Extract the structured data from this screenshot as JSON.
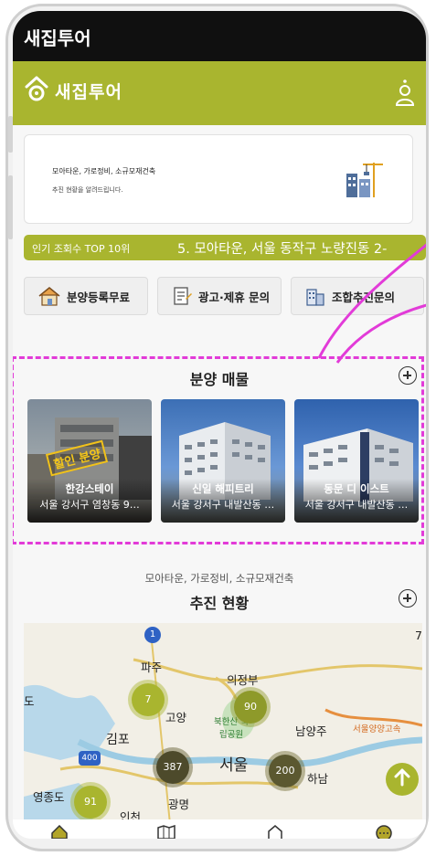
{
  "status_bar": {
    "title": "새집투어"
  },
  "app_bar": {
    "logo_text": "새집투어",
    "icons": [
      "logo-house-icon",
      "user-icon"
    ]
  },
  "banner": {
    "title": "모아타운, 가로정비, 소규모재건축",
    "subtitle": "추진 현황을 알려드립니다.",
    "icon": "building-crane-icon"
  },
  "ticker": {
    "label": "인기 조회수 TOP 10위",
    "text": "5. 모아타운, 서울 동작구 노량진동 2-"
  },
  "quick_buttons": [
    {
      "label": "분양등록무료",
      "icon": "house-icon"
    },
    {
      "label": "광고·제휴 문의",
      "icon": "document-icon"
    },
    {
      "label": "조합추진문의",
      "icon": "apartment-icon"
    }
  ],
  "sale_section": {
    "title": "분양 매물",
    "items": [
      {
        "name": "한강스테이",
        "address": "서울 강서구 염창동 9…",
        "stamp": "할인 분양"
      },
      {
        "name": "신일 해피트리",
        "address": "서울 강서구 내발산동 …"
      },
      {
        "name": "동문 디 이스트",
        "address": "서울 강서구 내발산동 …"
      }
    ]
  },
  "progress_section": {
    "caption": "모아타운, 가로정비, 소규모재건축",
    "title": "추진 현황"
  },
  "map": {
    "labels": [
      "파주",
      "의정부",
      "고양",
      "북한산 국립공원",
      "김포",
      "남양주",
      "서울",
      "하남",
      "영종도",
      "광명",
      "인천",
      "도",
      "서울양양고속",
      "7"
    ],
    "route_badges": [
      "1",
      "400"
    ],
    "clusters": [
      {
        "count": "7"
      },
      {
        "count": "90"
      },
      {
        "count": "387"
      },
      {
        "count": "200"
      },
      {
        "count": "91"
      }
    ]
  },
  "bottom_nav": [
    "home-icon",
    "map-icon",
    "house-outline-icon",
    "chat-icon"
  ],
  "colors": {
    "accent": "#a9b52f",
    "highlight": "#e23bd8",
    "statusbar": "#101010"
  }
}
